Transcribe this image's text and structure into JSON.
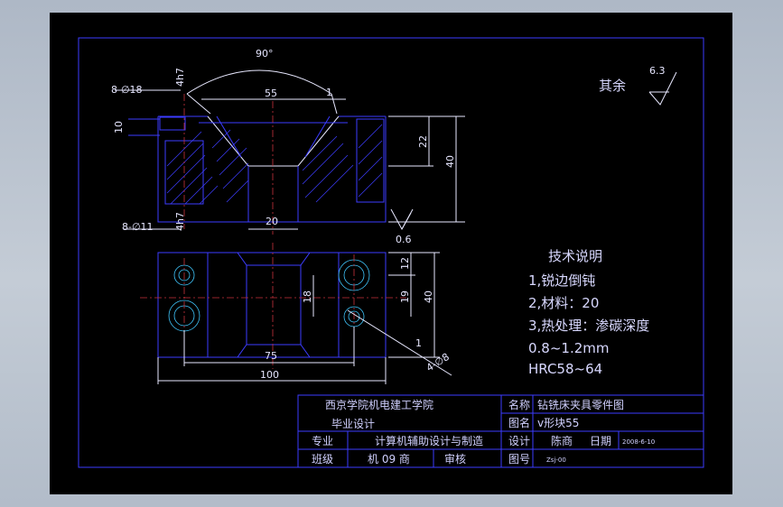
{
  "dims": {
    "angle": "90°",
    "hole_top": "8-∅18",
    "depth_top": "4h7",
    "width_55": "55",
    "chamfer": "1",
    "height_10": "10",
    "height_22": "22",
    "height_40": "40",
    "hole_bottom": "8-∅11",
    "depth_bottom": "4h7",
    "width_20": "20",
    "roughness_small": "0.6",
    "plan_12": "12",
    "plan_18": "18",
    "plan_19": "19",
    "plan_40": "40",
    "plan_75": "75",
    "plan_100": "100",
    "plan_chamfer": "1",
    "plan_hole": "4-∅8"
  },
  "surface": {
    "label": "其余",
    "value": "6.3"
  },
  "notes": {
    "title": "技术说明",
    "line1": "1,锐边倒钝",
    "line2": "2,材料：20",
    "line3": "3,热处理：渗碳深度",
    "line4": "0.8~1.2mm",
    "line5": "HRC58~64"
  },
  "title_block": {
    "school": "西京学院机电建工学院",
    "design_type": "毕业设计",
    "name_label": "名称",
    "name_value": "钻铣床夹具零件图",
    "drawing_label": "图名",
    "drawing_value": "v形块55",
    "major_label": "专业",
    "major_value": "计算机辅助设计与制造",
    "designer_label": "设计",
    "designer_value": "陈商",
    "date_label": "日期",
    "date_value": "2008-6-10",
    "class_label": "班级",
    "class_value": "机 09 商",
    "reviewer_label": "审核",
    "number_label": "图号",
    "number_value": "Zsj-00"
  }
}
